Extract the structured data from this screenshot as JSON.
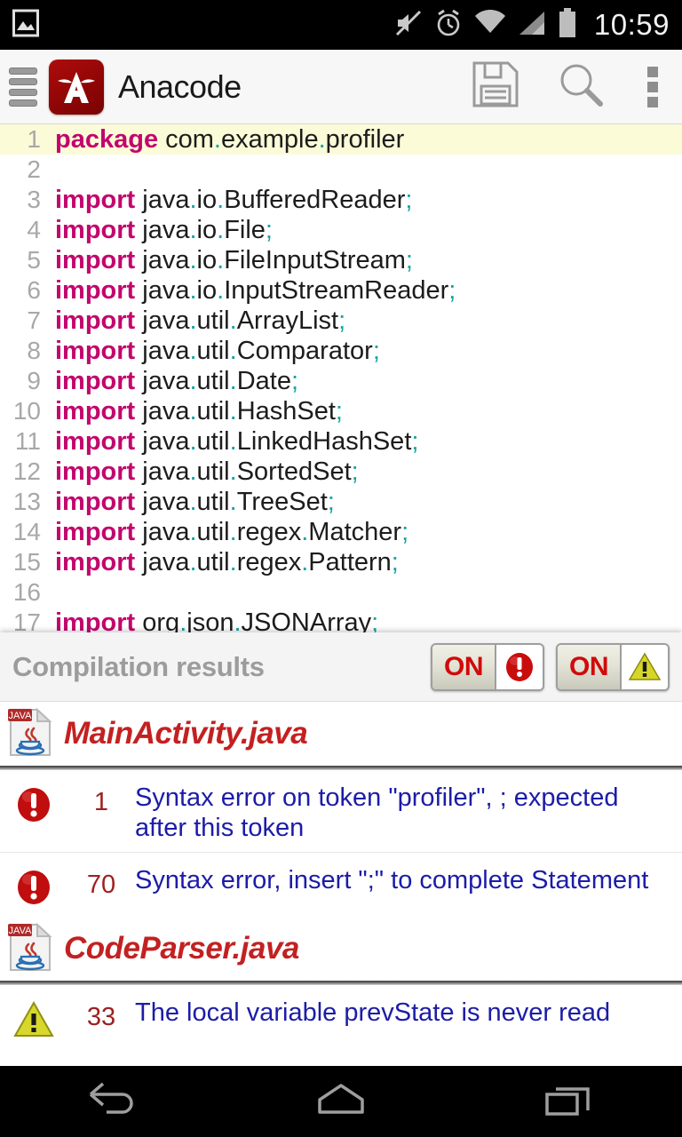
{
  "statusbar": {
    "time": "10:59",
    "icons": [
      "image-icon",
      "mute-icon",
      "alarm-icon",
      "wifi-icon",
      "signal-icon",
      "battery-icon"
    ]
  },
  "appbar": {
    "drawer_icon": "stack-drawer-icon",
    "logo_icon": "anacode-logo-icon",
    "title": "Anacode",
    "actions": [
      {
        "icon": "save-icon",
        "name": "save-button"
      },
      {
        "icon": "search-icon",
        "name": "search-button"
      },
      {
        "icon": "overflow-menu-icon",
        "name": "overflow-menu-button"
      }
    ]
  },
  "editor": {
    "lines": [
      {
        "n": "1",
        "kw": "package",
        "rest": " com.example.profiler",
        "highlight": true
      },
      {
        "n": "2",
        "kw": "",
        "rest": ""
      },
      {
        "n": "3",
        "kw": "import",
        "rest": " java.io.BufferedReader;"
      },
      {
        "n": "4",
        "kw": "import",
        "rest": " java.io.File;"
      },
      {
        "n": "5",
        "kw": "import",
        "rest": " java.io.FileInputStream;"
      },
      {
        "n": "6",
        "kw": "import",
        "rest": " java.io.InputStreamReader;"
      },
      {
        "n": "7",
        "kw": "import",
        "rest": " java.util.ArrayList;"
      },
      {
        "n": "8",
        "kw": "import",
        "rest": " java.util.Comparator;"
      },
      {
        "n": "9",
        "kw": "import",
        "rest": " java.util.Date;"
      },
      {
        "n": "10",
        "kw": "import",
        "rest": " java.util.HashSet;"
      },
      {
        "n": "11",
        "kw": "import",
        "rest": " java.util.LinkedHashSet;"
      },
      {
        "n": "12",
        "kw": "import",
        "rest": " java.util.SortedSet;"
      },
      {
        "n": "13",
        "kw": "import",
        "rest": " java.util.TreeSet;"
      },
      {
        "n": "14",
        "kw": "import",
        "rest": " java.util.regex.Matcher;"
      },
      {
        "n": "15",
        "kw": "import",
        "rest": " java.util.regex.Pattern;"
      },
      {
        "n": "16",
        "kw": "",
        "rest": ""
      },
      {
        "n": "17",
        "kw": "import",
        "rest": " org.json.JSONArray;"
      }
    ]
  },
  "panel": {
    "title": "Compilation results",
    "toggles": [
      {
        "label": "ON",
        "icon": "error-icon",
        "name": "toggle-errors"
      },
      {
        "label": "ON",
        "icon": "warning-icon",
        "name": "toggle-warnings"
      }
    ],
    "files": [
      {
        "name": "MainActivity.java",
        "icon": "java-file-icon",
        "issues": [
          {
            "severity": "error",
            "line": "1",
            "message": "Syntax error on token \"profiler\", ; expected after this token"
          },
          {
            "severity": "error",
            "line": "70",
            "message": "Syntax error, insert \";\" to complete Statement"
          }
        ]
      },
      {
        "name": "CodeParser.java",
        "icon": "java-file-icon",
        "issues": [
          {
            "severity": "warning",
            "line": "33",
            "message": "The local variable prevState is never read"
          }
        ]
      }
    ]
  },
  "navbar": {
    "buttons": [
      {
        "icon": "back-icon",
        "name": "nav-back-button"
      },
      {
        "icon": "home-icon",
        "name": "nav-home-button"
      },
      {
        "icon": "recents-icon",
        "name": "nav-recents-button"
      }
    ]
  },
  "colors": {
    "keyword": "#c2066e",
    "punctuation": "#12a3a3",
    "error_text": "#1c1ca8",
    "line_number": "#9e2020",
    "file_name": "#c32121",
    "brand_red": "#8e0505"
  }
}
